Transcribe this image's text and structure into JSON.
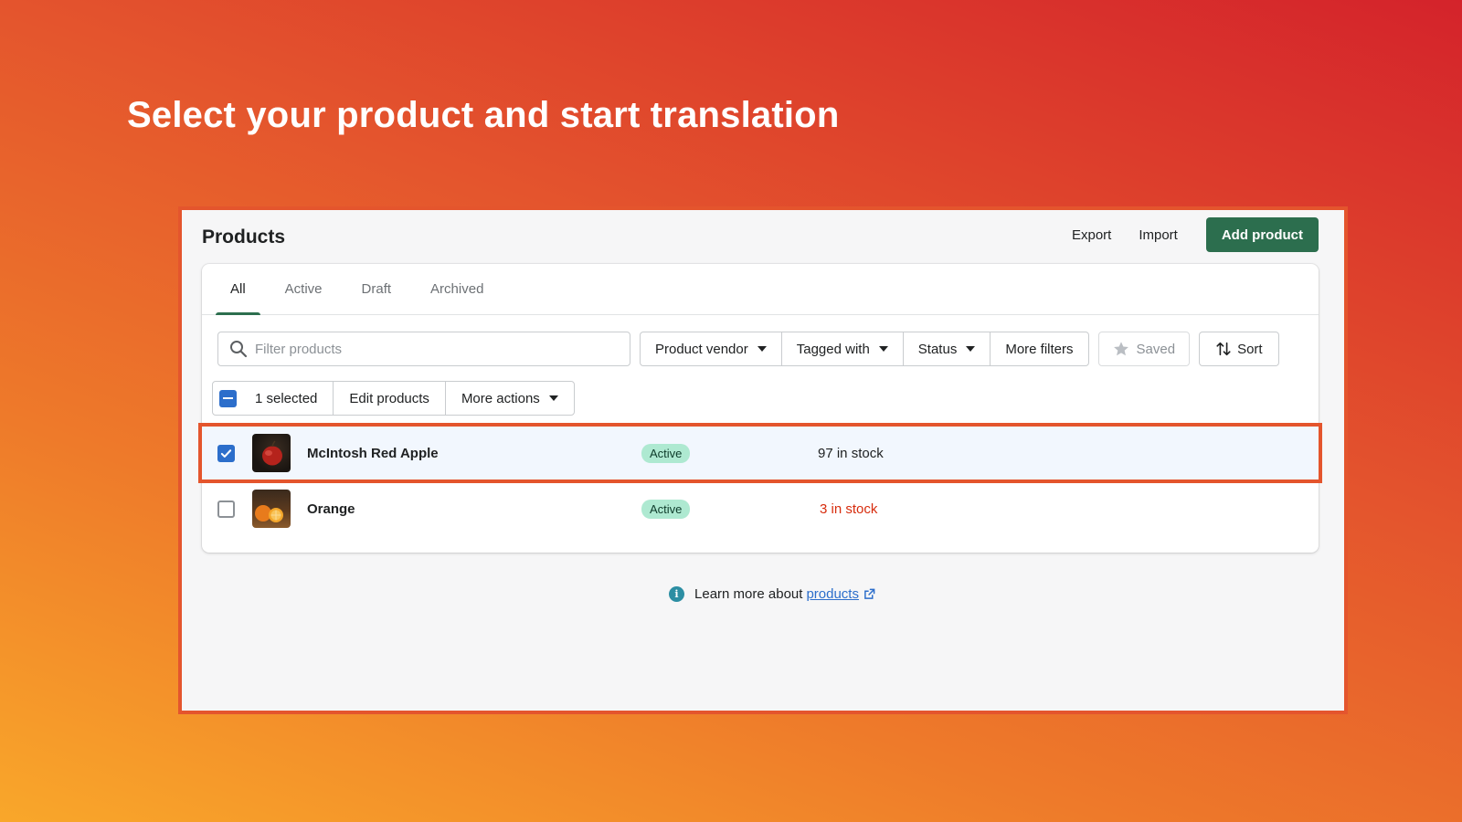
{
  "headline": "Select your product and start translation",
  "page": {
    "title": "Products",
    "export_label": "Export",
    "import_label": "Import",
    "add_label": "Add product"
  },
  "tabs": [
    {
      "label": "All",
      "active": true
    },
    {
      "label": "Active",
      "active": false
    },
    {
      "label": "Draft",
      "active": false
    },
    {
      "label": "Archived",
      "active": false
    }
  ],
  "filters": {
    "search_placeholder": "Filter products",
    "search_icon": "search-icon",
    "vendor_label": "Product vendor",
    "tagged_label": "Tagged with",
    "status_label": "Status",
    "more_filters_label": "More filters",
    "saved_label": "Saved",
    "sort_label": "Sort"
  },
  "bulk": {
    "selected_label": "1 selected",
    "edit_label": "Edit products",
    "more_actions_label": "More actions"
  },
  "products": [
    {
      "name": "McIntosh Red Apple",
      "status": "Active",
      "stock": "97 in stock",
      "checked": true,
      "thumbnail": "apple-thumbnail"
    },
    {
      "name": "Orange",
      "status": "Active",
      "stock": "3 in stock",
      "checked": false,
      "thumbnail": "orange-thumbnail"
    }
  ],
  "help": {
    "prefix": "Learn more about",
    "link_text": "products",
    "info_icon": "info-icon",
    "external_icon": "external-link-icon"
  },
  "colors": {
    "primary": "#2c6e4e",
    "checkbox": "#2c6ecb",
    "highlight_border": "#e4552d",
    "badge_bg": "#aee9d1",
    "low_stock": "#d72c0d",
    "link": "#2c6ecb"
  }
}
